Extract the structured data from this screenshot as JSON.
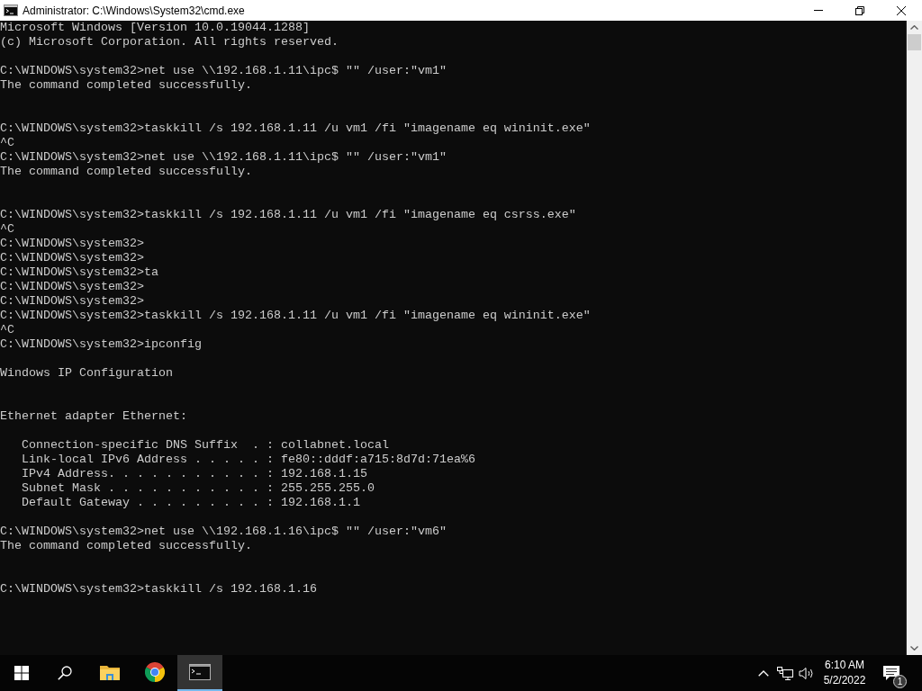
{
  "window": {
    "title": "Administrator: C:\\Windows\\System32\\cmd.exe"
  },
  "console": {
    "lines": [
      {
        "kind": "text",
        "text": "Microsoft Windows [Version 10.0.19044.1288]"
      },
      {
        "kind": "text",
        "text": "(c) Microsoft Corporation. All rights reserved."
      },
      {
        "kind": "blank"
      },
      {
        "kind": "text",
        "text": "C:\\WINDOWS\\system32>net use \\\\192.168.1.11\\ipc$ \"\" /user:\"vm1\""
      },
      {
        "kind": "text",
        "text": "The command completed successfully."
      },
      {
        "kind": "blank"
      },
      {
        "kind": "blank"
      },
      {
        "kind": "text",
        "text": "C:\\WINDOWS\\system32>taskkill /s 192.168.1.11 /u vm1 /fi \"imagename eq wininit.exe\""
      },
      {
        "kind": "text",
        "text": "^C"
      },
      {
        "kind": "text",
        "text": "C:\\WINDOWS\\system32>net use \\\\192.168.1.11\\ipc$ \"\" /user:\"vm1\""
      },
      {
        "kind": "text",
        "text": "The command completed successfully."
      },
      {
        "kind": "blank"
      },
      {
        "kind": "blank"
      },
      {
        "kind": "text",
        "text": "C:\\WINDOWS\\system32>taskkill /s 192.168.1.11 /u vm1 /fi \"imagename eq csrss.exe\""
      },
      {
        "kind": "text",
        "text": "^C"
      },
      {
        "kind": "text",
        "text": "C:\\WINDOWS\\system32>"
      },
      {
        "kind": "text",
        "text": "C:\\WINDOWS\\system32>"
      },
      {
        "kind": "text",
        "text": "C:\\WINDOWS\\system32>ta"
      },
      {
        "kind": "text",
        "text": "C:\\WINDOWS\\system32>"
      },
      {
        "kind": "text",
        "text": "C:\\WINDOWS\\system32>"
      },
      {
        "kind": "text",
        "text": "C:\\WINDOWS\\system32>taskkill /s 192.168.1.11 /u vm1 /fi \"imagename eq wininit.exe\""
      },
      {
        "kind": "text",
        "text": "^C"
      },
      {
        "kind": "text",
        "text": "C:\\WINDOWS\\system32>ipconfig"
      },
      {
        "kind": "blank"
      },
      {
        "kind": "text",
        "text": "Windows IP Configuration"
      },
      {
        "kind": "blank"
      },
      {
        "kind": "blank"
      },
      {
        "kind": "text",
        "text": "Ethernet adapter Ethernet:"
      },
      {
        "kind": "blank"
      },
      {
        "kind": "indented",
        "text": "Connection-specific DNS Suffix  . : collabnet.local"
      },
      {
        "kind": "indented",
        "text": "Link-local IPv6 Address . . . . . : fe80::dddf:a715:8d7d:71ea%6"
      },
      {
        "kind": "indented",
        "text": "IPv4 Address. . . . . . . . . . . : 192.168.1.15"
      },
      {
        "kind": "indented",
        "text": "Subnet Mask . . . . . . . . . . . : 255.255.255.0"
      },
      {
        "kind": "indented",
        "text": "Default Gateway . . . . . . . . . : 192.168.1.1"
      },
      {
        "kind": "blank"
      },
      {
        "kind": "text",
        "text": "C:\\WINDOWS\\system32>net use \\\\192.168.1.16\\ipc$ \"\" /user:\"vm6\""
      },
      {
        "kind": "text",
        "text": "The command completed successfully."
      },
      {
        "kind": "blank"
      },
      {
        "kind": "blank"
      },
      {
        "kind": "text",
        "text": "C:\\WINDOWS\\system32>taskkill /s 192.168.1.16"
      }
    ]
  },
  "taskbar": {
    "apps": [
      {
        "kind": "folder",
        "selected": false
      },
      {
        "kind": "browser",
        "selected": false
      },
      {
        "kind": "terminal",
        "selected": true
      }
    ],
    "clock": {
      "time": "6:10 AM",
      "date": "5/2/2022"
    },
    "notifications": {
      "badge": "1"
    }
  }
}
